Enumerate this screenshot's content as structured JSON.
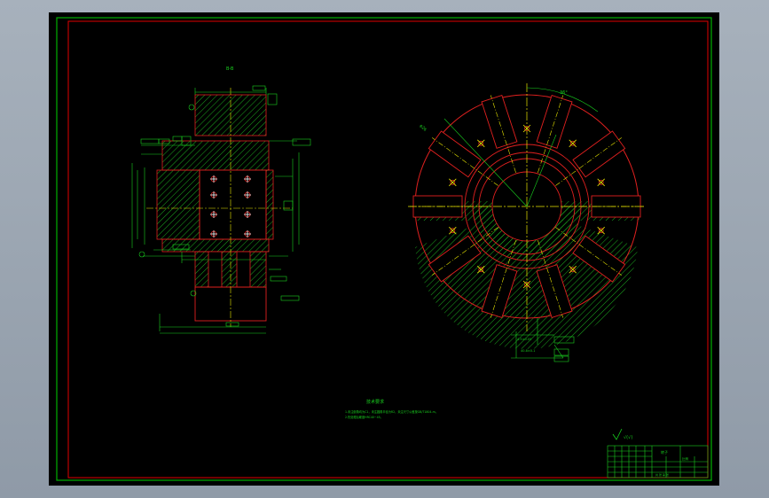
{
  "drawing": {
    "section_label": "B-B",
    "tech_requirements": {
      "title": "技术要求",
      "lines": [
        "1.未注倒角均为C1，未注圆角半径为R2，未注尺寸公差按GB/T1804-m。",
        "2.热处理后硬度HRC40~45。"
      ]
    },
    "title_block": {
      "part_name": "转子",
      "scale_label": "比例",
      "sheet_label": "共 张 第 张"
    },
    "roughness_symbol_text": "√(√)",
    "dims": {
      "angle_top": "36°",
      "dia_text": "φ26",
      "bottom_a": "4.5±0.05",
      "bottom_b": "40.8±0.1"
    }
  },
  "colors": {
    "background": "#000000",
    "frame_outer": "#00b000",
    "frame_inner": "#e00000",
    "outline": "#e0201f",
    "dimension": "#19d11f",
    "centerline": "#e8e600",
    "hole_marker": "#ffffff"
  }
}
